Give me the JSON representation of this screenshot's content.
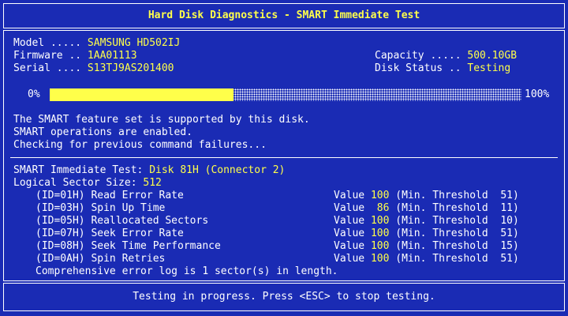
{
  "header": {
    "title": "Hard Disk Diagnostics - SMART Immediate Test"
  },
  "info": {
    "model_label": "Model ..... ",
    "model": "SAMSUNG HD502IJ",
    "firmware_label": "Firmware .. ",
    "firmware": "1AA01113",
    "serial_label": "Serial .... ",
    "serial": "S13TJ9AS201400",
    "capacity_label": "Capacity ..... ",
    "capacity": "500.10GB",
    "status_label": "Disk Status .. ",
    "status": "Testing"
  },
  "progress": {
    "start_label": "0%",
    "end_label": "100%",
    "value": 0.39
  },
  "messages": [
    "The SMART feature set is supported by this disk.",
    "SMART operations are enabled.",
    "Checking for previous command failures..."
  ],
  "test": {
    "label": "SMART Immediate Test: ",
    "disk": "Disk 81H (Connector 2)",
    "sector_label": "Logical Sector Size: ",
    "sector_size": "512",
    "attributes": [
      {
        "name": "(ID=01H) Read Error Rate",
        "value": "100",
        "threshold": "51"
      },
      {
        "name": "(ID=03H) Spin Up Time",
        "value": "86",
        "threshold": "11"
      },
      {
        "name": "(ID=05H) Reallocated Sectors",
        "value": "100",
        "threshold": "10"
      },
      {
        "name": "(ID=07H) Seek Error Rate",
        "value": "100",
        "threshold": "51"
      },
      {
        "name": "(ID=08H) Seek Time Performance",
        "value": "100",
        "threshold": "15"
      },
      {
        "name": "(ID=0AH) Spin Retries",
        "value": "100",
        "threshold": "51"
      }
    ],
    "value_prefix": "Value ",
    "threshold_prefix": "(Min. Threshold ",
    "threshold_suffix": ")",
    "error_log": "Comprehensive error log is 1 sector(s) in length."
  },
  "footer": {
    "message": "Testing in progress. Press <ESC> to stop testing."
  },
  "colors": {
    "background": "#1a2bb4",
    "highlight": "#ffff4a",
    "text": "#ffffff"
  }
}
